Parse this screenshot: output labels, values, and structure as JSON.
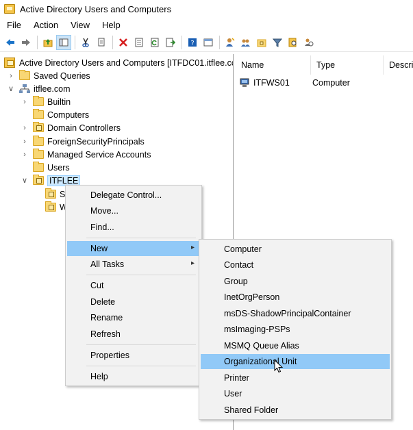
{
  "window": {
    "title": "Active Directory Users and Computers"
  },
  "menubar": {
    "items": [
      "File",
      "Action",
      "View",
      "Help"
    ]
  },
  "toolbar": {
    "buttons": [
      "back-arrow-icon",
      "forward-arrow-icon",
      "up-folder-icon",
      "show-hide-tree-icon",
      "cut-icon",
      "copy-icon",
      "delete-icon",
      "properties-icon",
      "refresh-icon",
      "export-list-icon",
      "help-icon",
      "console-icon",
      "add-user-icon",
      "add-group-icon",
      "add-ou-icon",
      "filter-icon",
      "find-icon",
      "delegate-icon"
    ]
  },
  "tree": {
    "root": "Active Directory Users and Computers [ITFDC01.itflee.co",
    "saved_queries": "Saved Queries",
    "domain": "itflee.com",
    "children": [
      "Builtin",
      "Computers",
      "Domain Controllers",
      "ForeignSecurityPrincipals",
      "Managed Service Accounts",
      "Users",
      "ITFLEE"
    ],
    "sub_s": "S",
    "sub_w": "W"
  },
  "list": {
    "columns": [
      "Name",
      "Type",
      "Descrip"
    ],
    "rows": [
      {
        "name": "ITFWS01",
        "type": "Computer"
      }
    ]
  },
  "context_menu": {
    "items": [
      "Delegate Control...",
      "Move...",
      "Find...",
      "New",
      "All Tasks",
      "Cut",
      "Delete",
      "Rename",
      "Refresh",
      "Properties",
      "Help"
    ]
  },
  "submenu": {
    "items": [
      "Computer",
      "Contact",
      "Group",
      "InetOrgPerson",
      "msDS-ShadowPrincipalContainer",
      "msImaging-PSPs",
      "MSMQ Queue Alias",
      "Organizational Unit",
      "Printer",
      "User",
      "Shared Folder"
    ]
  },
  "colors": {
    "highlight": "#91c9f7",
    "tree_selected": "#cce8ff",
    "folder": "#f8d775"
  }
}
